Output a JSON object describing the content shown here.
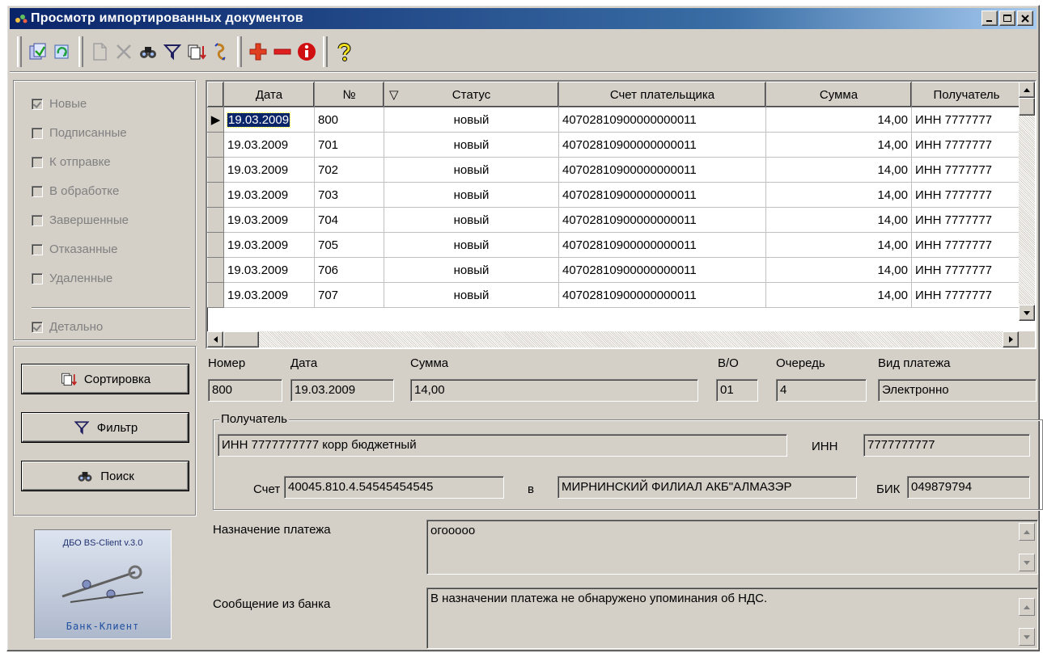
{
  "window": {
    "title": "Просмотр импортированных документов",
    "title_bg": "#0a246a"
  },
  "toolbar": {
    "icons": [
      "import-docs-icon",
      "refresh-icon",
      "new-doc-icon",
      "delete-icon",
      "search-icon",
      "filter-icon",
      "sort-icon",
      "exchange-icon",
      "add-icon",
      "remove-icon",
      "info-icon",
      "help-icon"
    ]
  },
  "left_panel": {
    "checkboxes": [
      {
        "label": "Новые",
        "checked": true
      },
      {
        "label": "Подписанные",
        "checked": false
      },
      {
        "label": "К отправке",
        "checked": false
      },
      {
        "label": "В обработке",
        "checked": false
      },
      {
        "label": "Завершенные",
        "checked": false
      },
      {
        "label": "Отказанные",
        "checked": false
      },
      {
        "label": "Удаленные",
        "checked": false
      }
    ],
    "detail_checkbox": {
      "label": "Детально",
      "checked": true
    },
    "buttons": {
      "sort": "Сортировка",
      "filter": "Фильтр",
      "search": "Поиск"
    },
    "logo": {
      "top_text": "ДБО BS-Client v.3.0",
      "bottom_text": "Банк-Клиент"
    }
  },
  "grid": {
    "columns": [
      "Дата",
      "№",
      "Статус",
      "Счет плательщика",
      "Сумма",
      "Получатель"
    ],
    "rows": [
      {
        "date": "19.03.2009",
        "num": "800",
        "status": "новый",
        "account": "40702810900000000011",
        "sum": "14,00",
        "recipient": "ИНН 7777777"
      },
      {
        "date": "19.03.2009",
        "num": "701",
        "status": "новый",
        "account": "40702810900000000011",
        "sum": "14,00",
        "recipient": "ИНН 7777777"
      },
      {
        "date": "19.03.2009",
        "num": "702",
        "status": "новый",
        "account": "40702810900000000011",
        "sum": "14,00",
        "recipient": "ИНН 7777777"
      },
      {
        "date": "19.03.2009",
        "num": "703",
        "status": "новый",
        "account": "40702810900000000011",
        "sum": "14,00",
        "recipient": "ИНН 7777777"
      },
      {
        "date": "19.03.2009",
        "num": "704",
        "status": "новый",
        "account": "40702810900000000011",
        "sum": "14,00",
        "recipient": "ИНН 7777777"
      },
      {
        "date": "19.03.2009",
        "num": "705",
        "status": "новый",
        "account": "40702810900000000011",
        "sum": "14,00",
        "recipient": "ИНН 7777777"
      },
      {
        "date": "19.03.2009",
        "num": "706",
        "status": "новый",
        "account": "40702810900000000011",
        "sum": "14,00",
        "recipient": "ИНН 7777777"
      },
      {
        "date": "19.03.2009",
        "num": "707",
        "status": "новый",
        "account": "40702810900000000011",
        "sum": "14,00",
        "recipient": "ИНН 7777777"
      }
    ]
  },
  "details": {
    "labels": {
      "number": "Номер",
      "date": "Дата",
      "sum": "Сумма",
      "vo": "В/О",
      "queue": "Очередь",
      "payment_type": "Вид платежа",
      "recipient_group": "Получатель",
      "inn": "ИНН",
      "account": "Счет",
      "in": "в",
      "bik": "БИК",
      "purpose": "Назначение платежа",
      "bank_message": "Сообщение из банка"
    },
    "values": {
      "number": "800",
      "date": "19.03.2009",
      "sum": "14,00",
      "vo": "01",
      "queue": "4",
      "payment_type": "Электронно",
      "recipient_name": "ИНН 7777777777 корр бюджетный",
      "inn": "7777777777",
      "account": "40045.810.4.54545454545",
      "bank": "МИРНИНСКИЙ ФИЛИАЛ АКБ\"АЛМАЗЭР",
      "bik": "049879794",
      "purpose": "огооооо",
      "bank_message": "В назначении платежа не обнаружено упоминания об НДС."
    }
  }
}
